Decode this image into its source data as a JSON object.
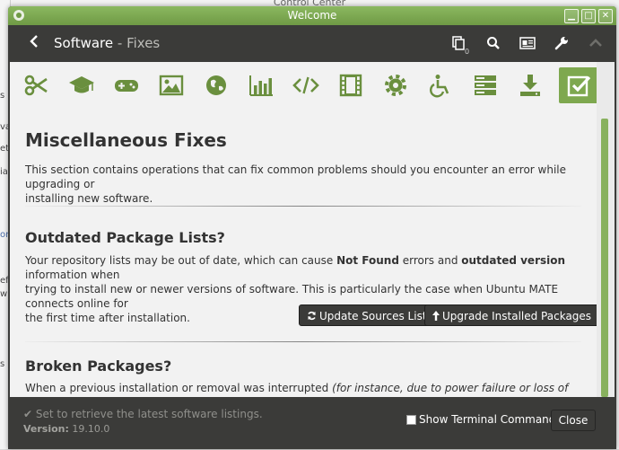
{
  "background_window": {
    "title": "Control Center",
    "sidebar_fragments": [
      "s",
      "va",
      "et",
      "ia",
      "on",
      "ef",
      "wi",
      "s"
    ]
  },
  "window": {
    "title": "Welcome",
    "controls": {
      "minimize": "▁",
      "maximize": "□",
      "close": "✕"
    }
  },
  "header": {
    "back_icon": "chevron-left-icon",
    "title": "Software",
    "separator": " - ",
    "subtitle": "Fixes",
    "queue_count": "0",
    "icons": [
      "copy-icon",
      "search-icon",
      "news-icon",
      "wrench-icon",
      "chevron-up-icon"
    ]
  },
  "categories": [
    {
      "icon": "scissors-icon",
      "active": false
    },
    {
      "icon": "graduation-cap-icon",
      "active": false
    },
    {
      "icon": "gamepad-icon",
      "active": false
    },
    {
      "icon": "image-icon",
      "active": false
    },
    {
      "icon": "globe-icon",
      "active": false
    },
    {
      "icon": "bar-chart-icon",
      "active": false
    },
    {
      "icon": "code-icon",
      "active": false
    },
    {
      "icon": "film-icon",
      "active": false
    },
    {
      "icon": "cog-icon",
      "active": false
    },
    {
      "icon": "accessibility-icon",
      "active": false
    },
    {
      "icon": "server-icon",
      "active": false
    },
    {
      "icon": "download-icon",
      "active": false
    },
    {
      "icon": "check-square-icon",
      "active": true
    }
  ],
  "main": {
    "heading": "Miscellaneous Fixes",
    "intro_line1": "This section contains operations that can fix common problems should you encounter an error while upgrading or",
    "intro_line2": "installing new software.",
    "outdated": {
      "heading": "Outdated Package Lists?",
      "p1_a": "Your repository lists may be out of date, which can cause ",
      "p1_b": "Not Found",
      "p1_c": " errors and ",
      "p1_d": "outdated version",
      "p1_e": " information when",
      "line2": "trying to install new or newer versions of software. This is particularly the case when Ubuntu MATE connects online for",
      "line3": "the first time after installation.",
      "btn_update": "Update Sources List",
      "btn_upgrade": "Upgrade Installed Packages"
    },
    "broken": {
      "heading": "Broken Packages?",
      "text_a": "When a previous installation or removal was interrupted ",
      "text_b": "(for instance, due to power failure or loss of Internet"
    }
  },
  "footer": {
    "status": "Set to retrieve the latest software listings.",
    "version_label": "Version:",
    "version": "19.10.0",
    "terminal_label": "Show Terminal Commands",
    "close_label": "Close"
  },
  "colors": {
    "accent": "#7ea84f",
    "dark": "#3b3b39",
    "icon": "#6a8f3e"
  }
}
